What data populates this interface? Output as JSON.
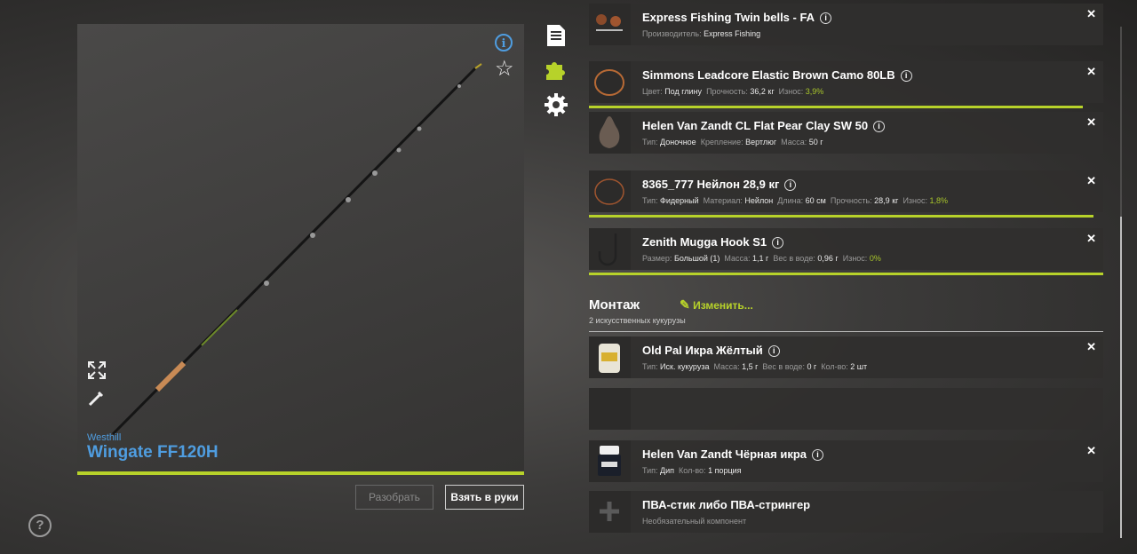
{
  "rod": {
    "brand": "Westhill",
    "name": "Wingate FF120H",
    "disassemble_label": "Разобрать",
    "take_label": "Взять в руки"
  },
  "items": [
    {
      "title": "Express Fishing Twin bells - FA",
      "sub": [
        {
          "k": "Производитель:",
          "v": "Express Fishing"
        }
      ]
    },
    {
      "title": "Simmons Leadcore Elastic Brown Camo 80LB",
      "sub": [
        {
          "k": "Цвет:",
          "v": "Под глину"
        },
        {
          "k": "Прочность:",
          "v": "36,2 кг"
        },
        {
          "k": "Износ:",
          "v": "3,9%",
          "green": true
        }
      ]
    },
    {
      "title": "Helen Van Zandt CL Flat Pear Clay SW 50",
      "sub": [
        {
          "k": "Тип:",
          "v": "Доночное"
        },
        {
          "k": "Крепление:",
          "v": "Вертлюг"
        },
        {
          "k": "Масса:",
          "v": "50 г"
        }
      ]
    },
    {
      "title": "8365_777 Нейлон 28,9 кг",
      "sub": [
        {
          "k": "Тип:",
          "v": "Фидерный"
        },
        {
          "k": "Материал:",
          "v": "Нейлон"
        },
        {
          "k": "Длина:",
          "v": "60 см"
        },
        {
          "k": "Прочность:",
          "v": "28,9 кг"
        },
        {
          "k": "Износ:",
          "v": "1,8%",
          "green": true
        }
      ]
    },
    {
      "title": "Zenith Mugga Hook S1",
      "sub": [
        {
          "k": "Размер:",
          "v": "Большой (1)"
        },
        {
          "k": "Масса:",
          "v": "1,1 г"
        },
        {
          "k": "Вес в воде:",
          "v": "0,96 г"
        },
        {
          "k": "Износ:",
          "v": "0%",
          "green": true
        }
      ]
    }
  ],
  "assembly": {
    "title": "Монтаж",
    "subtitle": "2 искусственных кукурузы",
    "change_label": "Изменить..."
  },
  "baits": [
    {
      "title": "Old Pal Икра Жёлтый",
      "sub": [
        {
          "k": "Тип:",
          "v": "Иск. кукуруза"
        },
        {
          "k": "Масса:",
          "v": "1,5 г"
        },
        {
          "k": "Вес в воде:",
          "v": "0 г"
        },
        {
          "k": "Кол-во:",
          "v": "2 шт"
        }
      ]
    },
    {
      "title": "",
      "sub": []
    },
    {
      "title": "Helen Van Zandt Чёрная икра",
      "sub": [
        {
          "k": "Тип:",
          "v": "Дип"
        },
        {
          "k": "Кол-во:",
          "v": "1 порция"
        }
      ]
    },
    {
      "title": "ПВА-стик либо ПВА-стрингер",
      "sub_text": "Необязательный компонент"
    }
  ],
  "colors": {
    "accent": "#b7d22a",
    "link": "#4f9de0"
  }
}
